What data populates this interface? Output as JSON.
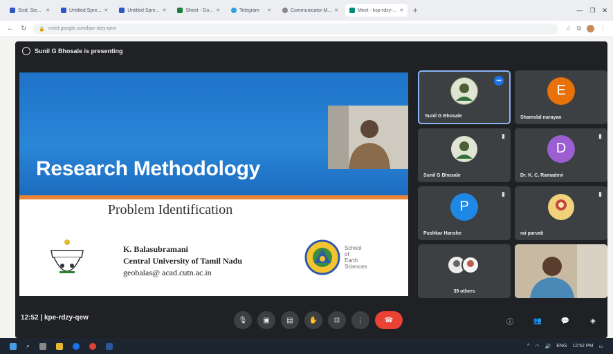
{
  "browser": {
    "tabs": [
      {
        "label": "Scid. Sie...",
        "active": false
      },
      {
        "label": "Untitled Spre...",
        "active": false
      },
      {
        "label": "Untitled Spre...",
        "active": false
      },
      {
        "label": "Sheet - Go...",
        "active": false
      },
      {
        "label": "Telegram",
        "active": false
      },
      {
        "label": "Communicator M...",
        "active": false
      },
      {
        "label": "Meet - ksp-rdzy-...",
        "active": true
      }
    ],
    "url": "meet.google.com/kpe-rdzy-qew"
  },
  "meet": {
    "presenting_label": "Sunil G Bhosale is presenting",
    "meeting_time": "12:52",
    "meeting_code": "kpe-rdzy-qew",
    "participants": [
      {
        "name": "Sunil G Bhosale",
        "initial": "",
        "color": "#8a9b6a",
        "speaking": true
      },
      {
        "name": "Shamslal narayan",
        "initial": "E",
        "color": "#e8710a",
        "speaking": false
      },
      {
        "name": "Sunil G Bhosale",
        "initial": "",
        "color": "#8a9b6a",
        "speaking": false
      },
      {
        "name": "Dr. K. C. Ramadevi",
        "initial": "D",
        "color": "#9c5fd3",
        "speaking": false
      },
      {
        "name": "Pushkar Hanshe",
        "initial": "P",
        "color": "#1e88e5",
        "speaking": false
      },
      {
        "name": "rai parvati",
        "initial": "",
        "color": "#d8a54a",
        "speaking": false
      },
      {
        "name": "39 others",
        "initial": "",
        "color": "#5f6368",
        "speaking": false
      }
    ]
  },
  "slide": {
    "title": "Research Methodology",
    "subtitle": "Problem Identification",
    "author_name": "K. Balasubramani",
    "author_org": "Central University of Tamil Nadu",
    "author_email": "geobalas@ acad.cutn.ac.in",
    "school_line1": "School",
    "school_line2": "of",
    "school_line3": "Earth",
    "school_line4": "Sciences"
  },
  "taskbar": {
    "time": "12:52 PM",
    "lang": "ENG"
  }
}
